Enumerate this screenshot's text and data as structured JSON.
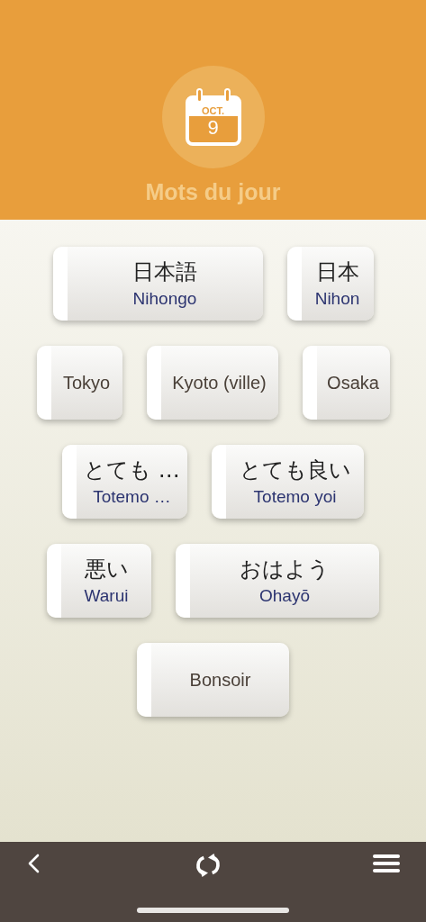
{
  "header": {
    "calendar": {
      "month": "OCT.",
      "day": "9"
    },
    "title": "Mots du jour"
  },
  "rows": [
    [
      {
        "kind": "pair",
        "japanese": "日本語",
        "romaji": "Nihongo"
      },
      {
        "kind": "pair",
        "japanese": "日本",
        "romaji": "Nihon"
      }
    ],
    [
      {
        "kind": "single",
        "label": "Tokyo"
      },
      {
        "kind": "single",
        "label": "Kyoto (ville)"
      },
      {
        "kind": "single",
        "label": "Osaka"
      }
    ],
    [
      {
        "kind": "pair",
        "japanese": "とても …",
        "romaji": "Totemo …"
      },
      {
        "kind": "pair",
        "japanese": "とても良い",
        "romaji": "Totemo yoi"
      }
    ],
    [
      {
        "kind": "pair",
        "japanese": "悪い",
        "romaji": "Warui"
      },
      {
        "kind": "pair",
        "japanese": "おはよう",
        "romaji": "Ohayō"
      }
    ],
    [
      {
        "kind": "single",
        "label": "Bonsoir"
      }
    ]
  ]
}
